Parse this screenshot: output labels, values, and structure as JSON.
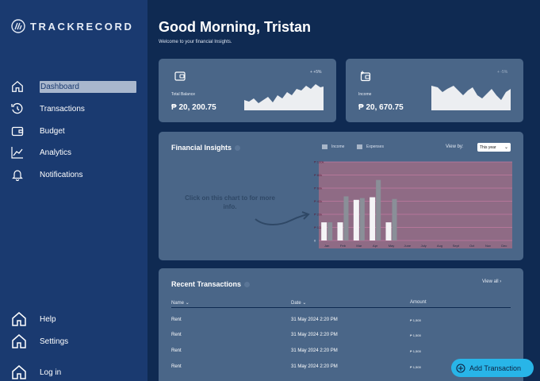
{
  "brand": {
    "name": "TRACKRECORD"
  },
  "sidebar": {
    "items": [
      {
        "label": "Dashboard",
        "icon": "home-icon",
        "active": true
      },
      {
        "label": "Transactions",
        "icon": "history-icon"
      },
      {
        "label": "Budget",
        "icon": "wallet-icon"
      },
      {
        "label": "Analytics",
        "icon": "trend-icon"
      },
      {
        "label": "Notifications",
        "icon": "bell-icon"
      }
    ],
    "bottom": [
      {
        "label": "Help",
        "icon": "home-icon"
      },
      {
        "label": "Settings",
        "icon": "home-icon"
      },
      {
        "label": "Log in",
        "icon": "home-icon"
      }
    ]
  },
  "header": {
    "greeting": "Good Morning, Tristan",
    "subtitle": "Welcome to your financial Insights."
  },
  "cards": {
    "balance": {
      "label": "Total Balance",
      "value": "₱ 20, 200.75",
      "change": "+ +5%",
      "icon": "wallet-icon"
    },
    "income": {
      "label": "Income",
      "value": "₱ 20, 670.75",
      "change": "+ -5%",
      "icon": "wallet-plus-icon"
    }
  },
  "insights": {
    "title": "Financial Insights",
    "legend_income": "Income",
    "legend_expenses": "Expenses",
    "view_by_label": "View by:",
    "view_by_value": "This year",
    "hint": "Click on this chart to for more info."
  },
  "chart_data": {
    "type": "bar",
    "categories": [
      "Jan",
      "Feb",
      "Mar",
      "Apr",
      "May",
      "June",
      "July",
      "Aug",
      "Sept",
      "Oct",
      "Nov",
      "Dec"
    ],
    "y_tick_labels": [
      "0",
      "₱ 10k",
      "₱ 20k",
      "₱ 40k",
      "₱ 60k",
      "₱ 80k",
      "₱ 100k"
    ],
    "series": [
      {
        "name": "Income",
        "values": [
          21,
          21,
          47,
          50,
          21,
          0,
          0,
          0,
          0,
          0,
          0,
          0
        ]
      },
      {
        "name": "Expenses",
        "values": [
          21,
          51,
          49,
          70,
          48,
          0,
          0,
          0,
          0,
          0,
          0,
          0
        ]
      }
    ],
    "colors": {
      "income": "#f4f4f6",
      "expenses": "#8a8f98",
      "band": "#8f6b85",
      "grid": "#c07aa0"
    }
  },
  "recent": {
    "title": "Recent Transactions",
    "view_all": "View all",
    "columns": [
      "Name",
      "Date",
      "Amount"
    ],
    "rows": [
      {
        "name": "Rent",
        "date": "31 May 2024 2:20 PM",
        "amount": "₱ 1,500"
      },
      {
        "name": "Rent",
        "date": "31 May 2024 2:20 PM",
        "amount": "₱ 1,500"
      },
      {
        "name": "Rent",
        "date": "31 May 2024 2:20 PM",
        "amount": "₱ 1,500"
      },
      {
        "name": "Rent",
        "date": "31 May 2024 2:20 PM",
        "amount": "₱ 1,500"
      }
    ]
  },
  "fab": {
    "label": "Add Transaction",
    "icon": "plus-circle-icon"
  },
  "colors": {
    "background": "#0f2a52",
    "sidebar": "#1a3a70",
    "card": "#4a6688",
    "accent": "#28b5e8"
  }
}
